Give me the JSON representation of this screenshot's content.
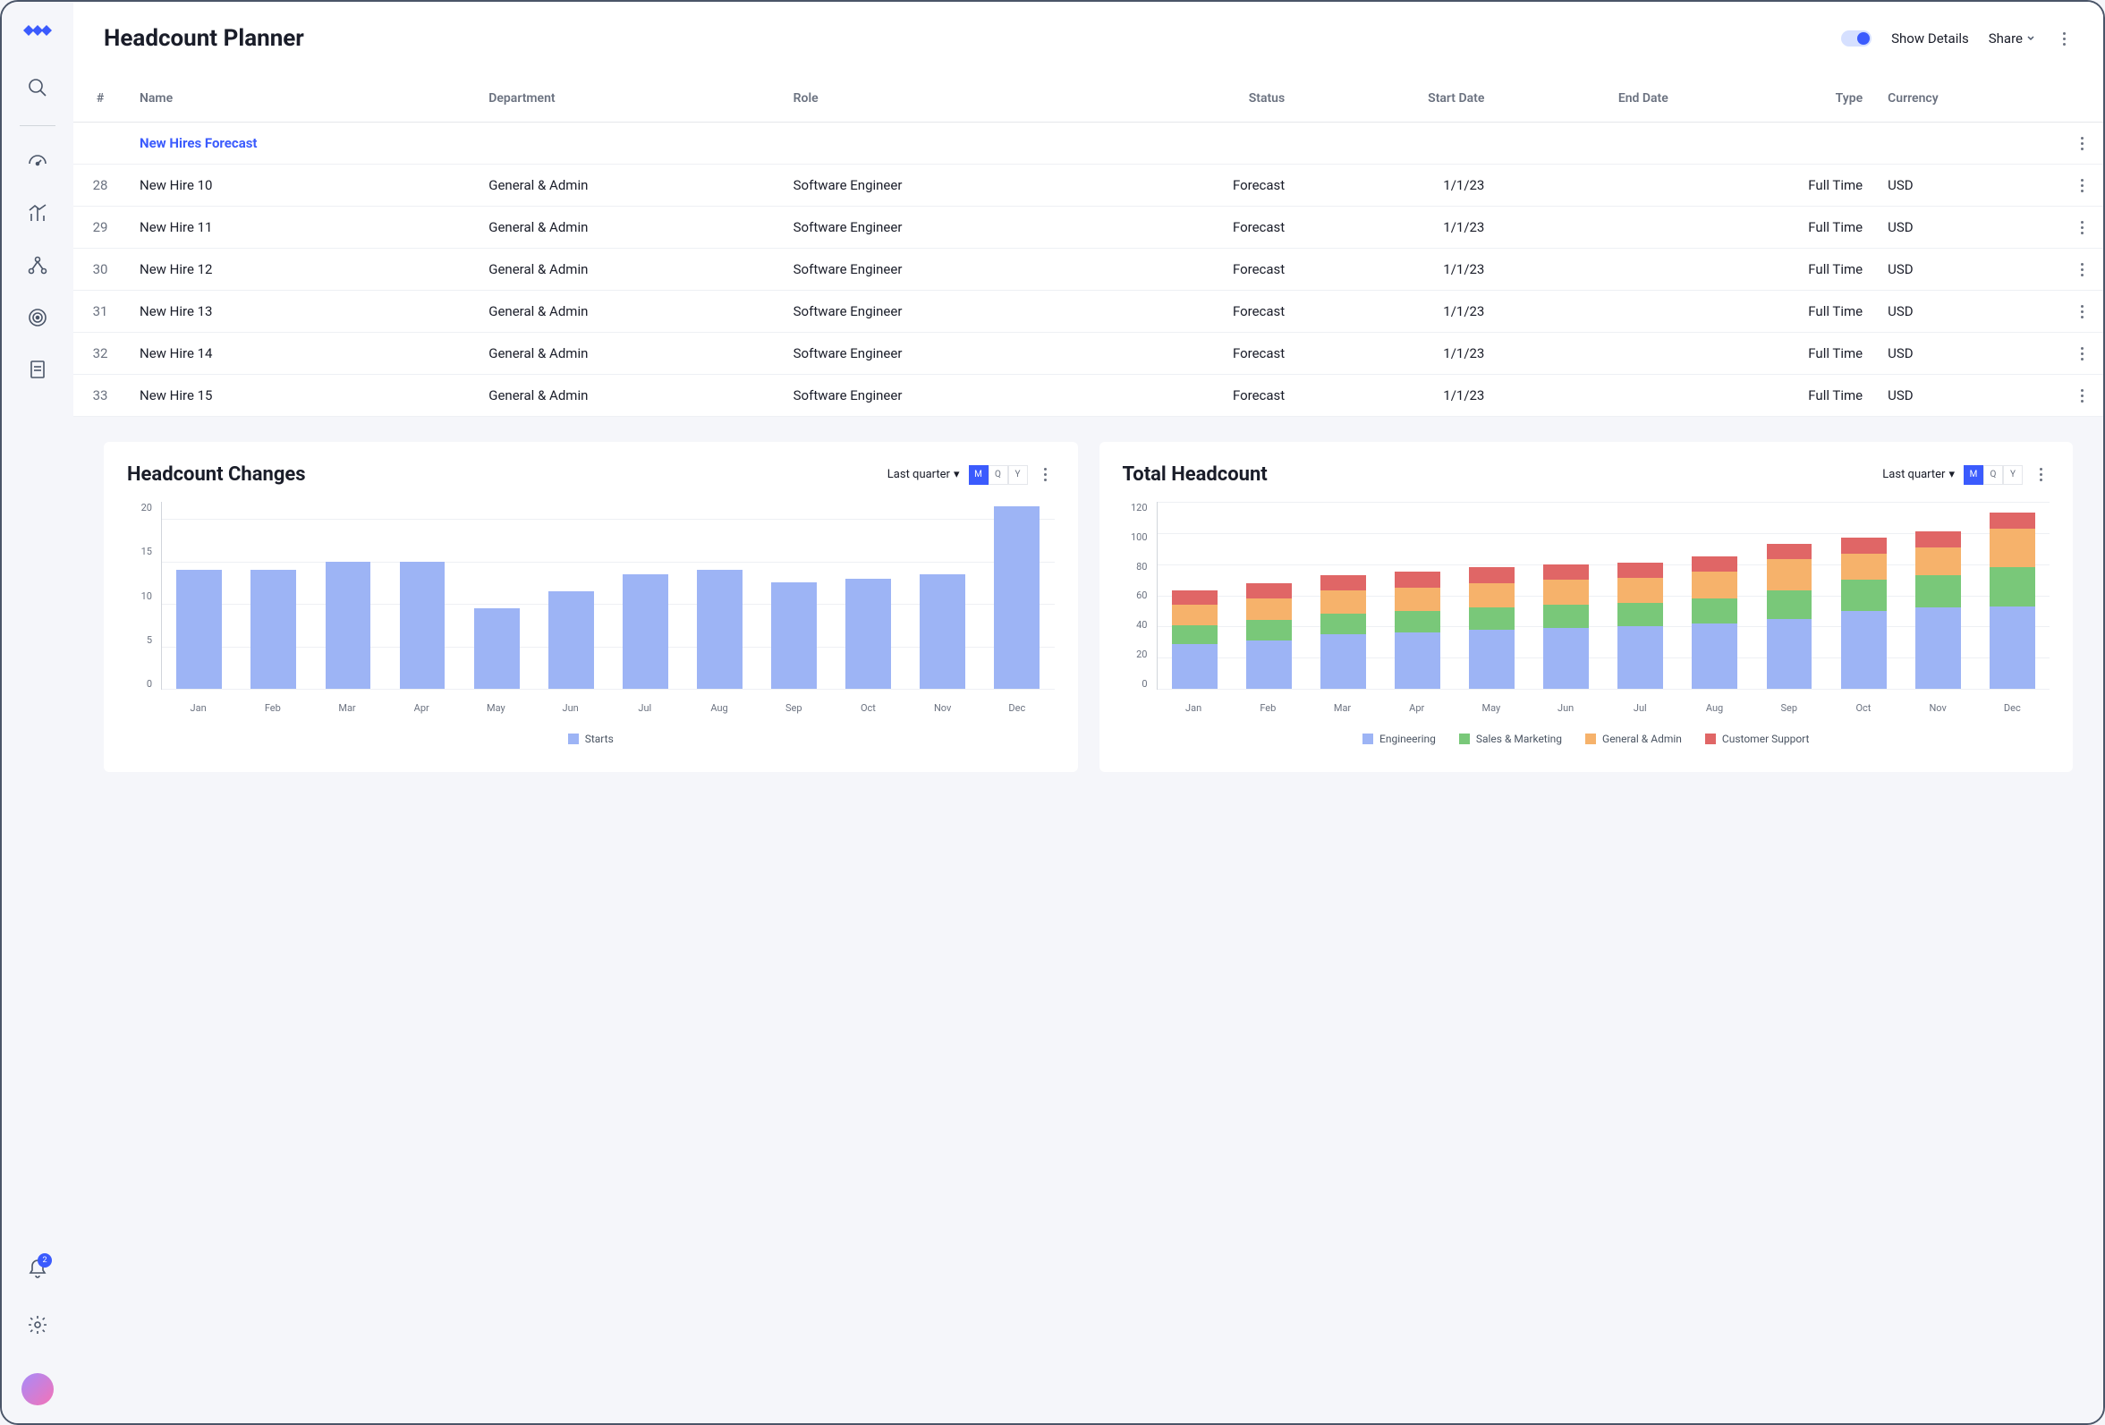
{
  "header": {
    "title": "Headcount Planner",
    "show_details_label": "Show Details",
    "share_label": "Share"
  },
  "sidebar": {
    "notification_count": "2"
  },
  "table": {
    "columns": {
      "num": "#",
      "name": "Name",
      "department": "Department",
      "role": "Role",
      "status": "Status",
      "start_date": "Start Date",
      "end_date": "End Date",
      "type": "Type",
      "currency": "Currency"
    },
    "section_label": "New Hires Forecast",
    "rows": [
      {
        "num": "28",
        "name": "New Hire 10",
        "department": "General & Admin",
        "role": "Software Engineer",
        "status": "Forecast",
        "start_date": "1/1/23",
        "end_date": "",
        "type": "Full Time",
        "currency": "USD"
      },
      {
        "num": "29",
        "name": "New Hire 11",
        "department": "General & Admin",
        "role": "Software Engineer",
        "status": "Forecast",
        "start_date": "1/1/23",
        "end_date": "",
        "type": "Full Time",
        "currency": "USD"
      },
      {
        "num": "30",
        "name": "New Hire 12",
        "department": "General & Admin",
        "role": "Software Engineer",
        "status": "Forecast",
        "start_date": "1/1/23",
        "end_date": "",
        "type": "Full Time",
        "currency": "USD"
      },
      {
        "num": "31",
        "name": "New Hire 13",
        "department": "General & Admin",
        "role": "Software Engineer",
        "status": "Forecast",
        "start_date": "1/1/23",
        "end_date": "",
        "type": "Full Time",
        "currency": "USD"
      },
      {
        "num": "32",
        "name": "New Hire 14",
        "department": "General & Admin",
        "role": "Software Engineer",
        "status": "Forecast",
        "start_date": "1/1/23",
        "end_date": "",
        "type": "Full Time",
        "currency": "USD"
      },
      {
        "num": "33",
        "name": "New Hire 15",
        "department": "General & Admin",
        "role": "Software Engineer",
        "status": "Forecast",
        "start_date": "1/1/23",
        "end_date": "",
        "type": "Full Time",
        "currency": "USD"
      }
    ]
  },
  "chart_data": [
    {
      "id": "headcount_changes",
      "title": "Headcount Changes",
      "type": "bar",
      "period_label": "Last quarter",
      "granularity_options": [
        "M",
        "Q",
        "Y"
      ],
      "granularity_active": "M",
      "categories": [
        "Jan",
        "Feb",
        "Mar",
        "Apr",
        "May",
        "Jun",
        "Jul",
        "Aug",
        "Sep",
        "Oct",
        "Nov",
        "Dec"
      ],
      "values": [
        14,
        14,
        15,
        15,
        9.5,
        11.5,
        13.5,
        14,
        12.5,
        13,
        13.5,
        21.5
      ],
      "ylim": [
        0,
        22
      ],
      "yticks": [
        0,
        5,
        10,
        15,
        20
      ],
      "series": [
        {
          "name": "Starts",
          "color": "#9db4f5"
        }
      ],
      "legend_label_0": "Starts"
    },
    {
      "id": "total_headcount",
      "title": "Total Headcount",
      "type": "bar",
      "period_label": "Last quarter",
      "granularity_options": [
        "M",
        "Q",
        "Y"
      ],
      "granularity_active": "M",
      "categories": [
        "Jan",
        "Feb",
        "Mar",
        "Apr",
        "May",
        "Jun",
        "Jul",
        "Aug",
        "Sep",
        "Oct",
        "Nov",
        "Dec"
      ],
      "ylim": [
        0,
        120
      ],
      "yticks": [
        0,
        20,
        40,
        60,
        80,
        100,
        120
      ],
      "series": [
        {
          "name": "Engineering",
          "color": "#9db4f5",
          "values": [
            29,
            31,
            35,
            36,
            38,
            39,
            40,
            42,
            45,
            50,
            52,
            53
          ]
        },
        {
          "name": "Sales & Marketing",
          "color": "#79c879",
          "values": [
            12,
            13,
            13,
            14,
            14,
            15,
            15,
            16,
            18,
            20,
            21,
            25
          ]
        },
        {
          "name": "General & Admin",
          "color": "#f6b26b",
          "values": [
            13,
            14,
            15,
            15,
            16,
            16,
            16,
            17,
            20,
            17,
            18,
            25
          ]
        },
        {
          "name": "Customer Support",
          "color": "#e06666",
          "values": [
            9,
            10,
            10,
            10,
            10,
            10,
            10,
            10,
            10,
            10,
            10,
            10
          ]
        }
      ],
      "legend_label_0": "Engineering",
      "legend_label_1": "Sales & Marketing",
      "legend_label_2": "General & Admin",
      "legend_label_3": "Customer Support"
    }
  ]
}
